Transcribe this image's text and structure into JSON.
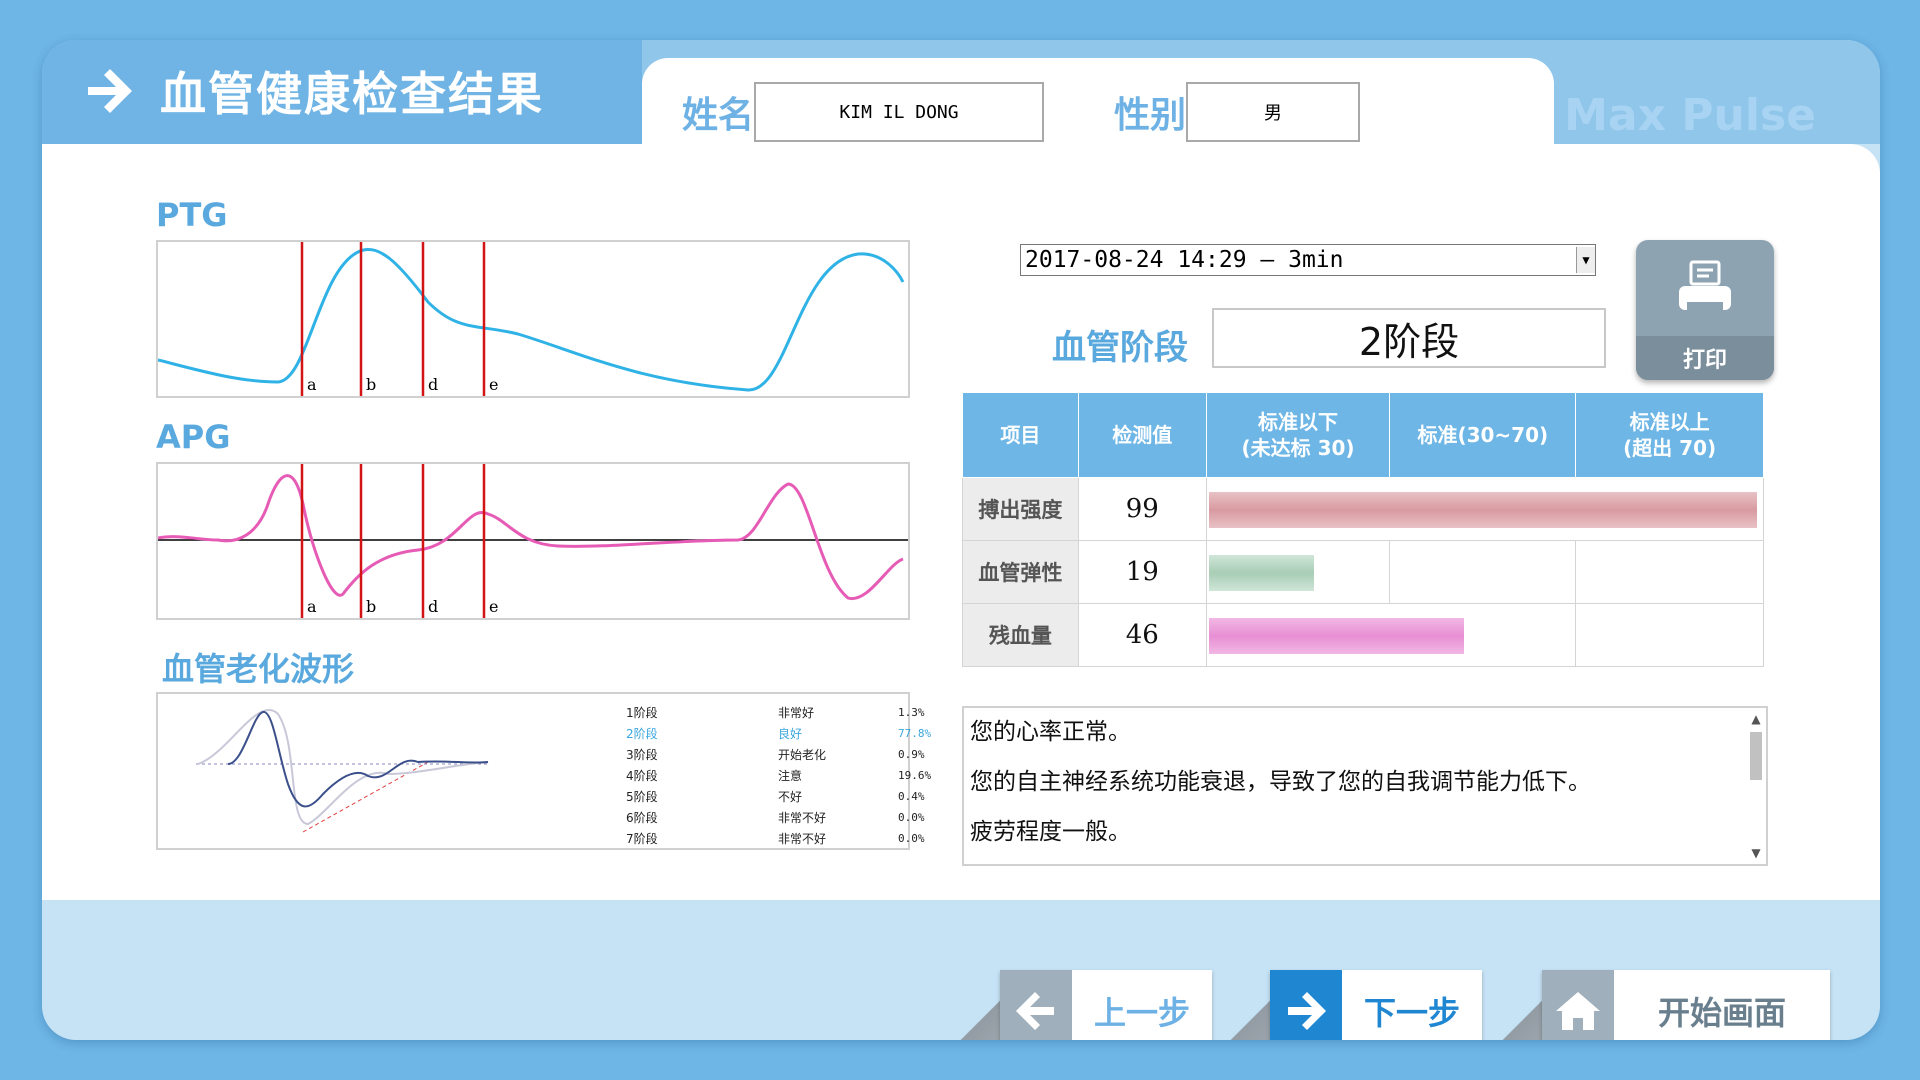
{
  "header": {
    "title": "血管健康检查结果",
    "name_label": "姓名",
    "name_value": "KIM IL DONG",
    "gender_label": "性别",
    "gender_value": "男",
    "brand": "Max Pulse"
  },
  "waveforms": {
    "ptg_label": "PTG",
    "apg_label": "APG",
    "aging_label": "血管老化波形",
    "markers": [
      "a",
      "b",
      "d",
      "e"
    ],
    "stages": [
      {
        "stage": "1阶段",
        "status": "非常好",
        "pct": "1.3%"
      },
      {
        "stage": "2阶段",
        "status": "良好",
        "pct": "77.8%"
      },
      {
        "stage": "3阶段",
        "status": "开始老化",
        "pct": "0.9%"
      },
      {
        "stage": "4阶段",
        "status": "注意",
        "pct": "19.6%"
      },
      {
        "stage": "5阶段",
        "status": "不好",
        "pct": "0.4%"
      },
      {
        "stage": "6阶段",
        "status": "非常不好",
        "pct": "0.0%"
      },
      {
        "stage": "7阶段",
        "status": "非常不好",
        "pct": "0.0%"
      }
    ]
  },
  "result": {
    "date_select": "2017-08-24 14:29 – 3min",
    "print_label": "打印",
    "stage_label": "血管阶段",
    "stage_value": "2阶段"
  },
  "metrics": {
    "headers": [
      "项目",
      "检测值",
      "标准以下\n(未达标 30)",
      "标准(30~70)",
      "标准以上\n(超出 70)"
    ],
    "rows": [
      {
        "item": "搏出强度",
        "value": "99",
        "level": 0.99,
        "color": "pink"
      },
      {
        "item": "血管弹性",
        "value": "19",
        "level": 0.19,
        "color": "green"
      },
      {
        "item": "残血量",
        "value": "46",
        "level": 0.46,
        "color": "magenta"
      }
    ]
  },
  "summary": {
    "lines": [
      "您的心率正常。",
      "您的自主神经系统功能衰退，导致了您的自我调节能力低下。",
      "疲劳程度一般。"
    ]
  },
  "nav": {
    "prev_label": "上一步",
    "next_label": "下一步",
    "home_label": "开始画面"
  },
  "colors": {
    "accent": "#6eb6e6",
    "active_nav": "#1f86d1",
    "inactive_nav": "#9fb0bc",
    "ptg_wave": "#2fb2e6",
    "apg_wave": "#e65bb5",
    "marker": "#d21414"
  }
}
